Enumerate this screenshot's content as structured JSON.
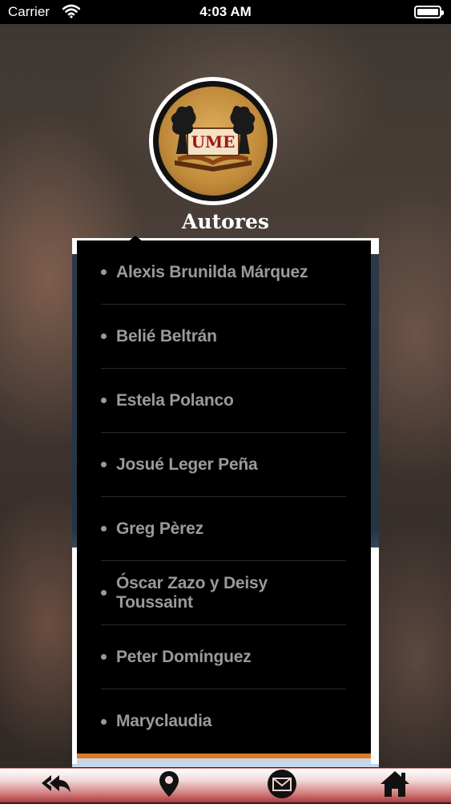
{
  "status_bar": {
    "carrier": "Carrier",
    "time": "4:03 AM"
  },
  "logo": {
    "text": "UME"
  },
  "page": {
    "title": "Autores"
  },
  "authors": [
    "Alexis Brunilda Márquez",
    "Belié Beltrán",
    "Estela Polanco",
    "Josué Leger Peña",
    "Greg Pèrez",
    "Óscar Zazo y Deisy Toussaint",
    "Peter Domínguez",
    "Maryclaudia"
  ],
  "tabbar": {
    "icons": [
      "reply-all-icon",
      "map-pin-icon",
      "mail-icon",
      "home-icon"
    ]
  },
  "colors": {
    "accent": "#e07820",
    "tab_red": "#b03838"
  }
}
